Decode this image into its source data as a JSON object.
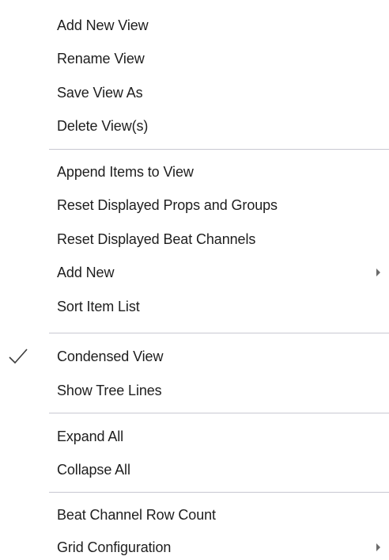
{
  "menu": {
    "items": [
      {
        "label": "Add New View"
      },
      {
        "label": "Rename View"
      },
      {
        "label": "Save View As"
      },
      {
        "label": "Delete View(s)"
      },
      {
        "label": "Append Items to View"
      },
      {
        "label": "Reset Displayed Props and Groups"
      },
      {
        "label": "Reset Displayed Beat Channels"
      },
      {
        "label": "Add New",
        "submenu": true
      },
      {
        "label": "Sort Item List"
      },
      {
        "label": "Condensed View",
        "checked": true
      },
      {
        "label": "Show Tree Lines"
      },
      {
        "label": "Expand All"
      },
      {
        "label": "Collapse All"
      },
      {
        "label": "Beat Channel Row Count"
      },
      {
        "label": "Grid Configuration",
        "submenu": true
      }
    ]
  },
  "icons": {
    "check": "checkmark-icon",
    "submenu": "submenu-arrow-icon"
  },
  "colors": {
    "background": "#ffffff",
    "text": "#1e1e1e",
    "separator": "#c8c8d2",
    "arrow": "#6b6b6b"
  }
}
